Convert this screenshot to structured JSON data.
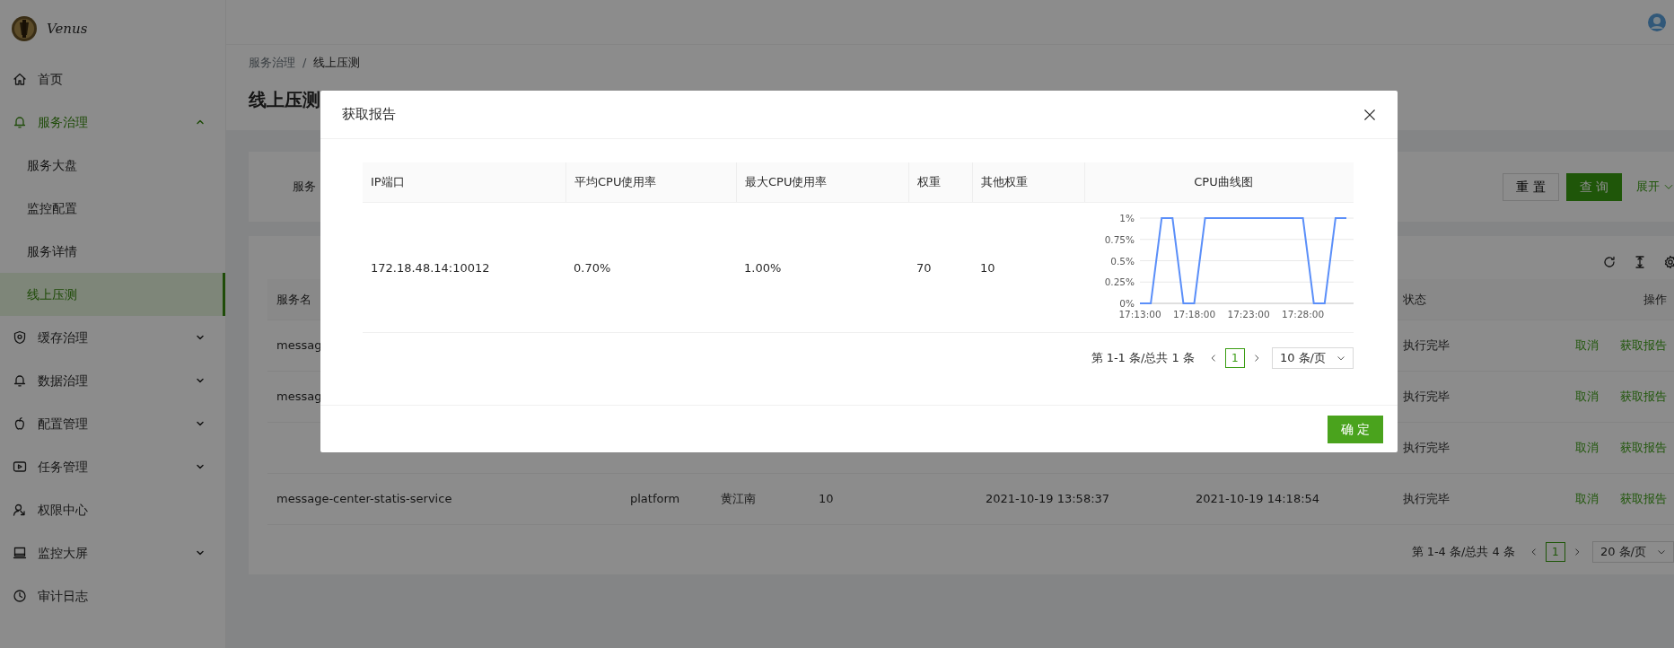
{
  "header": {
    "logo_text": "Venus"
  },
  "sidebar": {
    "items": [
      {
        "label": "首页",
        "kind": "link",
        "selected": false
      },
      {
        "label": "服务治理",
        "kind": "group",
        "selected": true,
        "expanded": true,
        "children": [
          {
            "label": "服务大盘",
            "selected": false
          },
          {
            "label": "监控配置",
            "selected": false
          },
          {
            "label": "服务详情",
            "selected": false
          },
          {
            "label": "线上压测",
            "selected": true
          }
        ]
      },
      {
        "label": "缓存治理",
        "kind": "group",
        "selected": false,
        "expanded": false
      },
      {
        "label": "数据治理",
        "kind": "group",
        "selected": false,
        "expanded": false
      },
      {
        "label": "配置管理",
        "kind": "group",
        "selected": false,
        "expanded": false
      },
      {
        "label": "任务管理",
        "kind": "group",
        "selected": false,
        "expanded": false
      },
      {
        "label": "权限中心",
        "kind": "link",
        "selected": false
      },
      {
        "label": "监控大屏",
        "kind": "group",
        "selected": false,
        "expanded": false
      },
      {
        "label": "审计日志",
        "kind": "link",
        "selected": false
      }
    ]
  },
  "breadcrumb": {
    "items": [
      "服务治理",
      "线上压测"
    ],
    "separator": "/"
  },
  "page_title": "线上压测",
  "query": {
    "label": "服务",
    "buttons": [
      {
        "label": "重 置",
        "kind": "default"
      },
      {
        "label": "查 询",
        "kind": "primary"
      }
    ],
    "expand": "展开"
  },
  "table": {
    "columns": {
      "service": "服务名",
      "status": "状态",
      "actions": "操作"
    },
    "rows": [
      {
        "service": "messag",
        "status": "执行完毕",
        "actions": [
          "取消",
          "获取报告"
        ]
      },
      {
        "service": "messag",
        "status": "执行完毕",
        "actions": [
          "取消",
          "获取报告"
        ]
      },
      {
        "status": "执行完毕",
        "actions": [
          "取消",
          "获取报告"
        ]
      },
      {
        "service": "message-center-statis-service",
        "line": "platform",
        "owner": "黄江南",
        "weight": "10",
        "start": "2021-10-19 13:58:37",
        "end": "2021-10-19 14:18:54",
        "status": "执行完毕",
        "actions": [
          "取消",
          "获取报告"
        ]
      }
    ],
    "pagination": {
      "summary": "第 1-4 条/总共 4 条",
      "pages": [
        {
          "label": "1",
          "selected": true
        }
      ],
      "page_size": "20 条/页"
    }
  },
  "modal": {
    "title": "获取报告",
    "columns": [
      "IP端口",
      "平均CPU使用率",
      "最大CPU使用率",
      "权重",
      "其他权重",
      "CPU曲线图"
    ],
    "rows": [
      {
        "cells": [
          "172.18.48.14:10012",
          "0.70%",
          "1.00%",
          "70",
          "10"
        ],
        "chart_data": {
          "type": "line",
          "grid": true,
          "categories": [
            "17:13:00",
            null,
            null,
            null,
            null,
            "17:18:00",
            null,
            null,
            null,
            null,
            "17:23:00",
            null,
            null,
            null,
            null,
            "17:28:00",
            null,
            null,
            null,
            null
          ],
          "series": [
            {
              "color": "#5b8ff9",
              "values": [
                0,
                0,
                1,
                1,
                0,
                0,
                1,
                1,
                1,
                1,
                1,
                1,
                1,
                1,
                1,
                1,
                0,
                0,
                1,
                1
              ]
            }
          ],
          "ylim": [
            0,
            1
          ],
          "yticks": [
            {
              "value": 0,
              "label": "0%"
            },
            {
              "value": 0.25,
              "label": "0.25%"
            },
            {
              "value": 0.5,
              "label": "0.5%"
            },
            {
              "value": 0.75,
              "label": "0.75%"
            },
            {
              "value": 1,
              "label": "1%"
            }
          ]
        }
      }
    ],
    "pagination": {
      "summary": "第 1-1 条/总共 1 条",
      "pages": [
        {
          "label": "1",
          "selected": true
        }
      ],
      "page_size": "10 条/页"
    },
    "ok": "确 定"
  }
}
